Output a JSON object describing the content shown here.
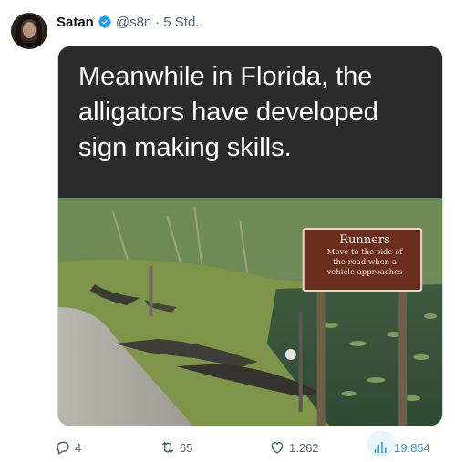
{
  "tweet": {
    "author_name": "Satan",
    "handle": "@s8n",
    "separator": "·",
    "time": "5 Std.",
    "verified": true,
    "caption_line1": "Meanwhile in Florida, the",
    "caption_line2": "alligators have developed",
    "caption_line3": "sign making skills.",
    "sign_title": "Runners",
    "sign_line1": "Move to the side of",
    "sign_line2": "the road when a",
    "sign_line3": "vehicle approaches"
  },
  "actions": {
    "replies": "4",
    "reposts": "65",
    "likes": "1.262",
    "views": "19.854"
  },
  "colors": {
    "accent": "#1d9bf0",
    "secondary_text": "#536471",
    "sign_background": "#6b2e1e"
  }
}
